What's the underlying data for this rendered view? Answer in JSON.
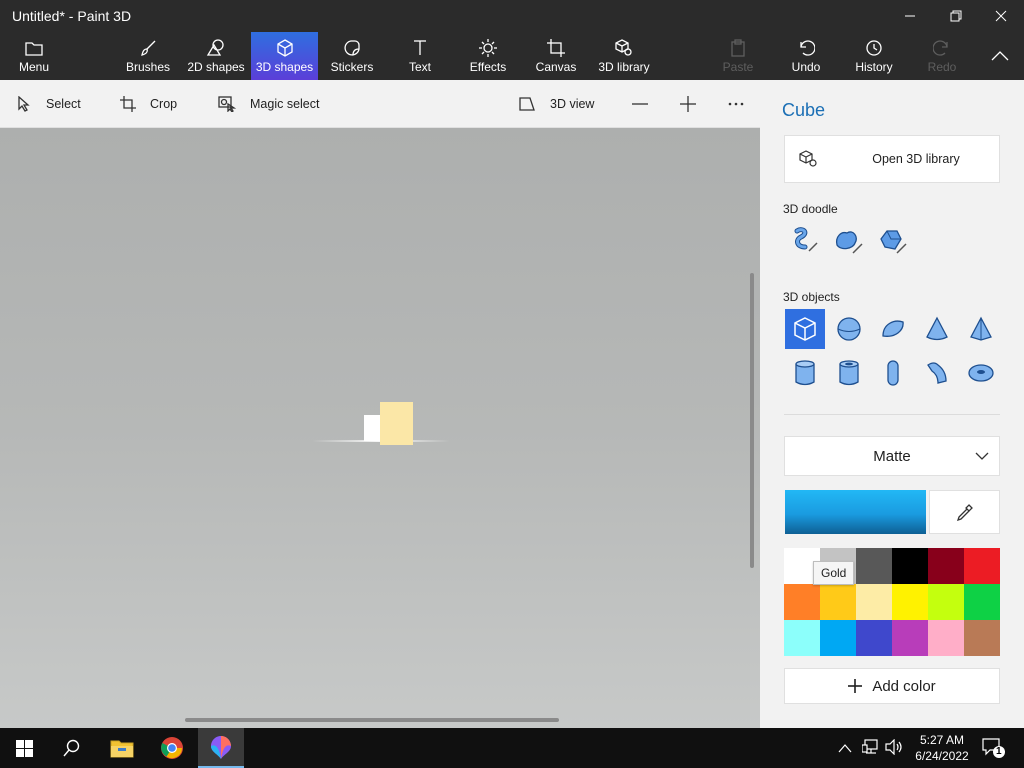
{
  "window": {
    "title": "Untitled* - Paint 3D"
  },
  "ribbon": {
    "menu": "Menu",
    "brushes": "Brushes",
    "shapes2d": "2D shapes",
    "shapes3d": "3D shapes",
    "stickers": "Stickers",
    "text": "Text",
    "effects": "Effects",
    "canvas": "Canvas",
    "library3d": "3D library",
    "paste": "Paste",
    "undo": "Undo",
    "history": "History",
    "redo": "Redo",
    "active_tab": "3D shapes"
  },
  "toolbar": {
    "select": "Select",
    "crop": "Crop",
    "magic_select": "Magic select",
    "view3d": "3D view"
  },
  "panel": {
    "title": "Cube",
    "open_library": "Open 3D library",
    "doodle_label": "3D doodle",
    "objects_label": "3D objects",
    "selected_object": "cube",
    "material": "Matte",
    "current_color": "#1a9be0",
    "tooltip": "Gold",
    "add_color": "Add color",
    "palette": [
      "#ffffff",
      "#c3c3c3",
      "#585858",
      "#000000",
      "#88001b",
      "#ec1c24",
      "#ff7f27",
      "#ffca18",
      "#fdeca6",
      "#fff200",
      "#c4ff0e",
      "#0ed145",
      "#8cfffb",
      "#00a8f3",
      "#3f48cc",
      "#b83dba",
      "#ffaec8",
      "#b97a56"
    ]
  },
  "taskbar": {
    "time": "5:27 AM",
    "date": "6/24/2022",
    "notification_count": "1"
  }
}
